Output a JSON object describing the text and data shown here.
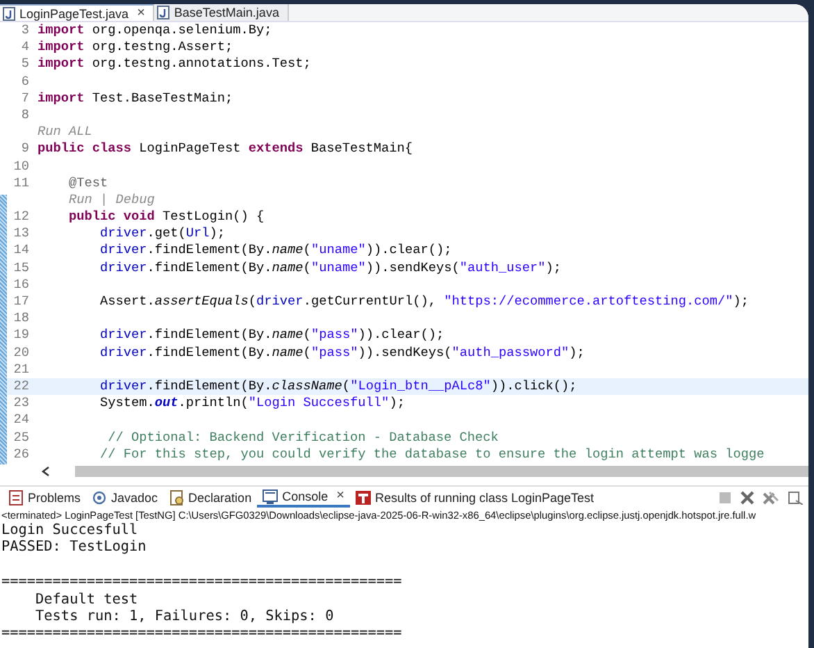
{
  "editor_tabs": [
    {
      "label": "LoginPageTest.java",
      "selected": true,
      "close": "×"
    },
    {
      "label": "BaseTestMain.java",
      "selected": false
    }
  ],
  "code_lines": [
    {
      "number": "3",
      "current": false,
      "tokens": [
        {
          "kind": "keyword",
          "text": "import"
        },
        {
          "kind": "plain",
          "text": " org.openqa.selenium.By;"
        }
      ]
    },
    {
      "number": "4",
      "current": false,
      "tokens": [
        {
          "kind": "keyword",
          "text": "import"
        },
        {
          "kind": "plain",
          "text": " org.testng.Assert;"
        }
      ]
    },
    {
      "number": "5",
      "current": false,
      "tokens": [
        {
          "kind": "keyword",
          "text": "import"
        },
        {
          "kind": "plain",
          "text": " org.testng.annotations.Test;"
        }
      ]
    },
    {
      "number": "6",
      "current": false
    },
    {
      "number": "7",
      "current": false,
      "tokens": [
        {
          "kind": "keyword",
          "text": "import"
        },
        {
          "kind": "plain",
          "text": " Test.BaseTestMain;"
        }
      ]
    },
    {
      "number": "8",
      "current": false
    },
    {
      "current": false,
      "tokens": [
        {
          "kind": "mining",
          "text": "Run ALL"
        }
      ]
    },
    {
      "number": "9",
      "current": false,
      "tokens": [
        {
          "kind": "keyword",
          "text": "public class"
        },
        {
          "kind": "plain",
          "text": " LoginPageTest "
        },
        {
          "kind": "keyword",
          "text": "extends"
        },
        {
          "kind": "plain",
          "text": " BaseTestMain{"
        }
      ]
    },
    {
      "number": "10",
      "current": false
    },
    {
      "number": "11",
      "current": false,
      "tokens": [
        {
          "kind": "annotation",
          "text": "    @Test"
        }
      ]
    },
    {
      "current": false,
      "tokens": [
        {
          "kind": "mining",
          "text": "    Run | Debug"
        }
      ]
    },
    {
      "number": "12",
      "current": false,
      "tokens": [
        {
          "kind": "keyword",
          "text": "    public void"
        },
        {
          "kind": "plain",
          "text": " TestLogin() {"
        }
      ]
    },
    {
      "number": "13",
      "current": false,
      "tokens": [
        {
          "kind": "field",
          "text": "        driver"
        },
        {
          "kind": "plain",
          "text": ".get("
        },
        {
          "kind": "field",
          "text": "Url"
        },
        {
          "kind": "plain",
          "text": ");"
        }
      ]
    },
    {
      "number": "14",
      "current": false,
      "tokens": [
        {
          "kind": "field",
          "text": "        driver"
        },
        {
          "kind": "plain",
          "text": ".findElement(By."
        },
        {
          "kind": "method",
          "text": "name"
        },
        {
          "kind": "plain",
          "text": "("
        },
        {
          "kind": "string",
          "text": "\"uname\""
        },
        {
          "kind": "plain",
          "text": ")).clear();"
        }
      ]
    },
    {
      "number": "15",
      "current": false,
      "tokens": [
        {
          "kind": "field",
          "text": "        driver"
        },
        {
          "kind": "plain",
          "text": ".findElement(By."
        },
        {
          "kind": "method",
          "text": "name"
        },
        {
          "kind": "plain",
          "text": "("
        },
        {
          "kind": "string",
          "text": "\"uname\""
        },
        {
          "kind": "plain",
          "text": ")).sendKeys("
        },
        {
          "kind": "string",
          "text": "\"auth_user\""
        },
        {
          "kind": "plain",
          "text": ");"
        }
      ]
    },
    {
      "number": "16",
      "current": false
    },
    {
      "number": "17",
      "current": false,
      "tokens": [
        {
          "kind": "plain",
          "text": "        Assert."
        },
        {
          "kind": "method",
          "text": "assertEquals"
        },
        {
          "kind": "plain",
          "text": "("
        },
        {
          "kind": "field",
          "text": "driver"
        },
        {
          "kind": "plain",
          "text": ".getCurrentUrl(), "
        },
        {
          "kind": "string",
          "text": "\"https://ecommerce.artoftesting.com/\""
        },
        {
          "kind": "plain",
          "text": ");"
        }
      ]
    },
    {
      "number": "18",
      "current": false
    },
    {
      "number": "19",
      "current": false,
      "tokens": [
        {
          "kind": "field",
          "text": "        driver"
        },
        {
          "kind": "plain",
          "text": ".findElement(By."
        },
        {
          "kind": "method",
          "text": "name"
        },
        {
          "kind": "plain",
          "text": "("
        },
        {
          "kind": "string",
          "text": "\"pass\""
        },
        {
          "kind": "plain",
          "text": ")).clear();"
        }
      ]
    },
    {
      "number": "20",
      "current": false,
      "tokens": [
        {
          "kind": "field",
          "text": "        driver"
        },
        {
          "kind": "plain",
          "text": ".findElement(By."
        },
        {
          "kind": "method",
          "text": "name"
        },
        {
          "kind": "plain",
          "text": "("
        },
        {
          "kind": "string",
          "text": "\"pass\""
        },
        {
          "kind": "plain",
          "text": ")).sendKeys("
        },
        {
          "kind": "string",
          "text": "\"auth_password\""
        },
        {
          "kind": "plain",
          "text": ");"
        }
      ]
    },
    {
      "number": "21",
      "current": false
    },
    {
      "number": "22",
      "current": true,
      "tokens": [
        {
          "kind": "field",
          "text": "        driver"
        },
        {
          "kind": "plain",
          "text": ".findElement(By."
        },
        {
          "kind": "method",
          "text": "className"
        },
        {
          "kind": "plain",
          "text": "("
        },
        {
          "kind": "string",
          "text": "\"Login_btn__pALc8\""
        },
        {
          "kind": "plain",
          "text": ")).click();"
        }
      ]
    },
    {
      "number": "23",
      "current": false,
      "tokens": [
        {
          "kind": "plain",
          "text": "        System."
        },
        {
          "kind": "static",
          "text": "out"
        },
        {
          "kind": "plain",
          "text": ".println("
        },
        {
          "kind": "string",
          "text": "\"Login Succesfull\""
        },
        {
          "kind": "plain",
          "text": ");"
        }
      ]
    },
    {
      "number": "24",
      "current": false
    },
    {
      "number": "25",
      "current": false,
      "tokens": [
        {
          "kind": "comment",
          "text": "         // Optional: Backend Verification - Database Check"
        }
      ]
    },
    {
      "number": "26",
      "current": false,
      "tokens": [
        {
          "kind": "comment",
          "text": "        // For this step, you could verify the database to ensure the login attempt was logge"
        }
      ]
    }
  ],
  "panel_tabs": [
    {
      "label": "Problems",
      "selected": false
    },
    {
      "label": "Javadoc",
      "selected": false
    },
    {
      "label": "Declaration",
      "selected": false
    },
    {
      "label": "Console",
      "selected": true,
      "close": "×"
    },
    {
      "label": "Results of running class LoginPageTest",
      "selected": false
    }
  ],
  "console_header": "<terminated> LoginPageTest [TestNG] C:\\Users\\GFG0329\\Downloads\\eclipse-java-2025-06-R-win32-x86_64\\eclipse\\plugins\\org.eclipse.justj.openjdk.hotspot.jre.full.w",
  "console_lines": [
    {
      "text": "Login Succesfull",
      "space_before": false
    },
    {
      "text": "PASSED: TestLogin",
      "space_before": false
    },
    {
      "text": "===============================================",
      "space_before": true
    },
    {
      "text": "    Default test",
      "space_before": false
    },
    {
      "text": "    Tests run: 1, Failures: 0, Skips: 0",
      "space_before": false
    },
    {
      "text": "===============================================",
      "space_before": false
    }
  ]
}
